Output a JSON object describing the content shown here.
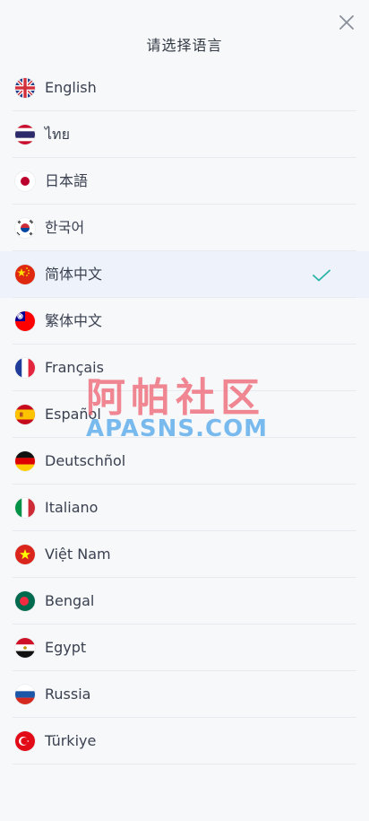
{
  "header": {
    "title": "请选择语言"
  },
  "languages": [
    {
      "label": "English",
      "flag": "uk-flag-icon",
      "selected": false
    },
    {
      "label": "ไทย",
      "flag": "thailand-flag-icon",
      "selected": false
    },
    {
      "label": "日本語",
      "flag": "japan-flag-icon",
      "selected": false
    },
    {
      "label": "한국어",
      "flag": "korea-flag-icon",
      "selected": false
    },
    {
      "label": "简体中文",
      "flag": "china-flag-icon",
      "selected": true
    },
    {
      "label": "繁体中文",
      "flag": "taiwan-flag-icon",
      "selected": false
    },
    {
      "label": "Français",
      "flag": "france-flag-icon",
      "selected": false
    },
    {
      "label": "Español",
      "flag": "spain-flag-icon",
      "selected": false
    },
    {
      "label": "Deutschñol",
      "flag": "germany-flag-icon",
      "selected": false
    },
    {
      "label": "Italiano",
      "flag": "italy-flag-icon",
      "selected": false
    },
    {
      "label": "Việt Nam",
      "flag": "vietnam-flag-icon",
      "selected": false
    },
    {
      "label": "Bengal",
      "flag": "bangladesh-flag-icon",
      "selected": false
    },
    {
      "label": "Egypt",
      "flag": "egypt-flag-icon",
      "selected": false
    },
    {
      "label": "Russia",
      "flag": "russia-flag-icon",
      "selected": false
    },
    {
      "label": "Türkiye",
      "flag": "turkey-flag-icon",
      "selected": false
    }
  ],
  "watermark": {
    "cn": "阿帕社区",
    "en": "APASNS.COM"
  },
  "colors": {
    "check": "#2ab3a6",
    "selected_bg": "#eef3fb",
    "separator": "#e7ebf0"
  }
}
